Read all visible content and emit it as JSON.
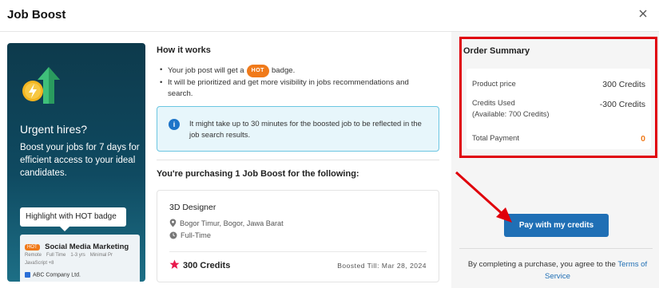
{
  "dialog": {
    "title": "Job Boost",
    "close_icon": "close-icon"
  },
  "promo": {
    "icon": "boost-rocket-icon",
    "title": "Urgent hires?",
    "text": "Boost your jobs for 7 days for efficient access to your ideal candidates.",
    "callout": "Highlight with HOT badge",
    "preview": {
      "hot": "HOT",
      "title": "Social Media Marketing",
      "tags": [
        "Remote",
        "Full Time",
        "1-3 yrs",
        "Minimal Pr"
      ],
      "tags2": "JavaScript  +8",
      "company": "ABC Company Ltd."
    }
  },
  "how_it_works": {
    "heading": "How it works",
    "bullet1_pre": "Your job post will get a",
    "hot_label": "HOT",
    "bullet1_post": "badge.",
    "bullet2": "It will be prioritized and get more visibility in jobs recommendations and search.",
    "info": "It might take up to 30 minutes for the boosted job to be reflected in the job search results."
  },
  "purchase": {
    "heading": "You're purchasing 1 Job Boost for the following:",
    "job_title": "3D Designer",
    "location": "Bogor Timur, Bogor, Jawa Barat",
    "employment": "Full-Time",
    "credits": "300 Credits",
    "boosted_till": "Boosted Till: Mar 28, 2024"
  },
  "order_summary": {
    "title": "Order Summary",
    "product_price_label": "Product price",
    "product_price_value": "300 Credits",
    "credits_used_label": "Credits Used",
    "credits_available": "(Available: 700 Credits)",
    "credits_used_value": "-300 Credits",
    "total_label": "Total Payment",
    "total_value": "0"
  },
  "pay_button": "Pay with my credits",
  "terms": {
    "text": "By completing a purchase, you agree to the",
    "link": "Terms of Service"
  },
  "colors": {
    "accent_blue": "#1f6fb5",
    "hot_orange": "#f07a1a",
    "highlight_red": "#e0000b",
    "info_bg": "#e7f6fb"
  }
}
